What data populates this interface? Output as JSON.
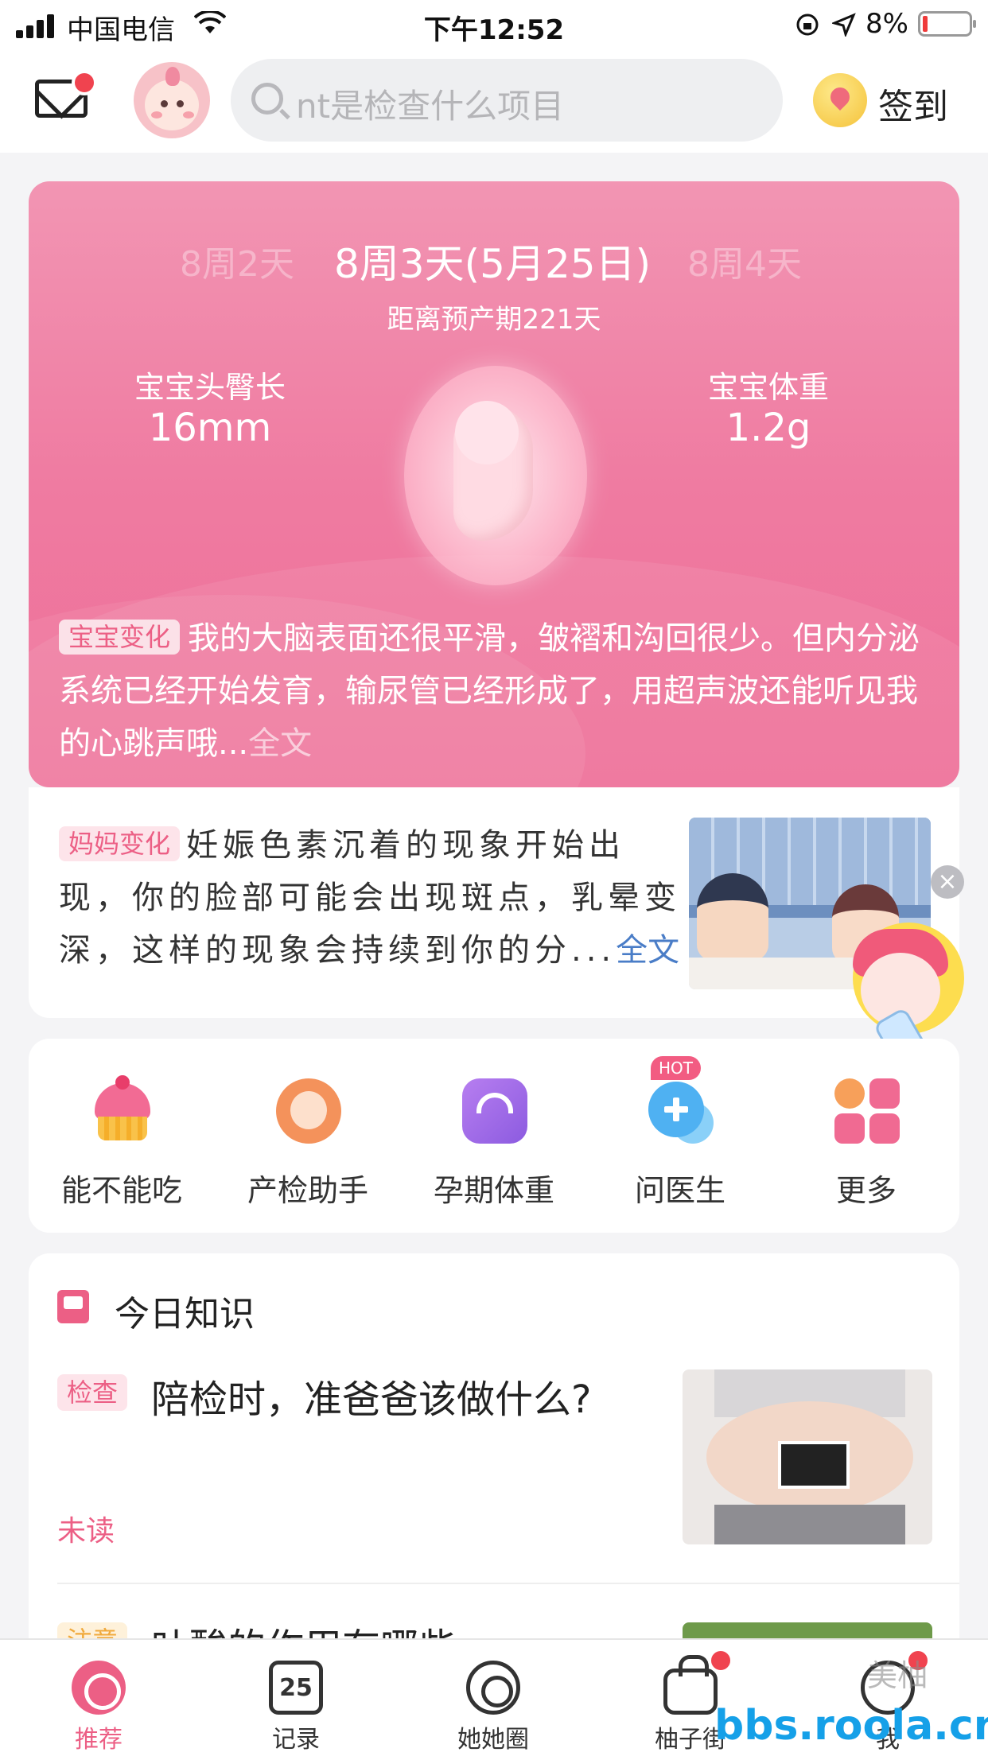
{
  "status_bar": {
    "carrier": "中国电信",
    "time": "下午12:52",
    "battery": "8%"
  },
  "header": {
    "search_placeholder": "nt是检查什么项目",
    "checkin_label": "签到"
  },
  "baby_card": {
    "week_prev": "8周2天",
    "week_current": "8周3天(5月25日)",
    "week_next": "8周4天",
    "due_countdown": "距离预产期221天",
    "length_label": "宝宝头臀长",
    "length_value": "16mm",
    "weight_label": "宝宝体重",
    "weight_value": "1.2g",
    "change_tag": "宝宝变化",
    "change_text": "我的大脑表面还很平滑，皱褶和沟回很少。但内分泌系统已经开始发育，输尿管已经形成了，用超声波还能听见我的心跳声哦...",
    "more_label": "全文"
  },
  "mom_card": {
    "tag": "妈妈变化",
    "text": "妊娠色素沉着的现象开始出现，你的脸部可能会出现斑点，乳晕变深，这样的现象会持续到你的分...",
    "more_label": "全文",
    "close_glyph": "×"
  },
  "tools": {
    "items": [
      {
        "label": "能不能吃",
        "icon": "cupcake-icon"
      },
      {
        "label": "产检助手",
        "icon": "prenatal-check-icon"
      },
      {
        "label": "孕期体重",
        "icon": "scale-icon"
      },
      {
        "label": "问医生",
        "icon": "ask-doctor-icon"
      },
      {
        "label": "更多",
        "icon": "more-grid-icon"
      }
    ],
    "hot_badge": "HOT"
  },
  "knowledge": {
    "title": "今日知识",
    "articles": [
      {
        "tag": "检查",
        "title": "陪检时，准爸爸该做什么?",
        "status": "未读"
      },
      {
        "tag": "注意",
        "title": "叶酸的作用有哪些"
      }
    ]
  },
  "tabbar": {
    "tabs": [
      {
        "label": "推荐",
        "active": true
      },
      {
        "label": "记录",
        "icon_text": "25"
      },
      {
        "label": "她她圈"
      },
      {
        "label": "柚子街"
      },
      {
        "label": "我"
      }
    ]
  },
  "watermark": {
    "site": "bbs.roola.cn",
    "brand": "美柚"
  },
  "colors": {
    "accent": "#ec5f85",
    "card_pink": "#ef7ba1",
    "badge_red": "#f0434f",
    "link_blue": "#4a7dc7"
  }
}
